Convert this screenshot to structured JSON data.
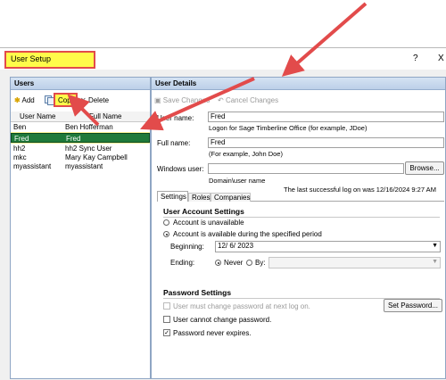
{
  "window": {
    "title": "User Setup",
    "help_glyph": "?",
    "close_glyph": "X"
  },
  "users_pane": {
    "header": "Users",
    "toolbar": {
      "add": "Add",
      "copy": "Copy",
      "delete": "Delete"
    },
    "columns": [
      "User Name",
      "Full Name"
    ],
    "rows": [
      {
        "user": "Ben",
        "full": "Ben Hofferman"
      },
      {
        "user": "Fred",
        "full": "Fred"
      },
      {
        "user": "hh2",
        "full": "hh2 Sync User"
      },
      {
        "user": "mkc",
        "full": "Mary Kay Campbell"
      },
      {
        "user": "myassistant",
        "full": "myassistant"
      }
    ]
  },
  "details": {
    "header": "User Details",
    "save_changes": "Save Changes",
    "cancel_changes": "Cancel Changes",
    "user_name_label": "User name:",
    "user_name_value": "Fred",
    "user_name_hint": "Logon for Sage Timberline Office (for example, JDoe)",
    "full_name_label": "Full name:",
    "full_name_value": "Fred",
    "full_name_hint": "(For example, John Doe)",
    "windows_user_label": "Windows user:",
    "windows_user_value": "",
    "browse": "Browse...",
    "windows_user_hint": "Domain\\user name",
    "last_logon": "The last successful log on was 12/16/2024 9:27 AM",
    "tabs": [
      "Settings",
      "Roles",
      "Companies"
    ],
    "account_section": "User Account Settings",
    "unavailable": "Account is unavailable",
    "available_period": "Account is available during the specified period",
    "beginning_label": "Beginning:",
    "beginning_value": "12/  6/ 2023",
    "ending_label": "Ending:",
    "never": "Never",
    "by": "By:",
    "password_section": "Password Settings",
    "must_change": "User must change password at next log on.",
    "cannot_change": "User cannot change password.",
    "never_expires": "Password never expires.",
    "set_password": "Set Password...",
    "checkmark": "✓"
  },
  "colors": {
    "selection_row": "#1f7a3a",
    "annotation_red": "#e24b4b",
    "annotation_yellow": "#fffb4a"
  }
}
